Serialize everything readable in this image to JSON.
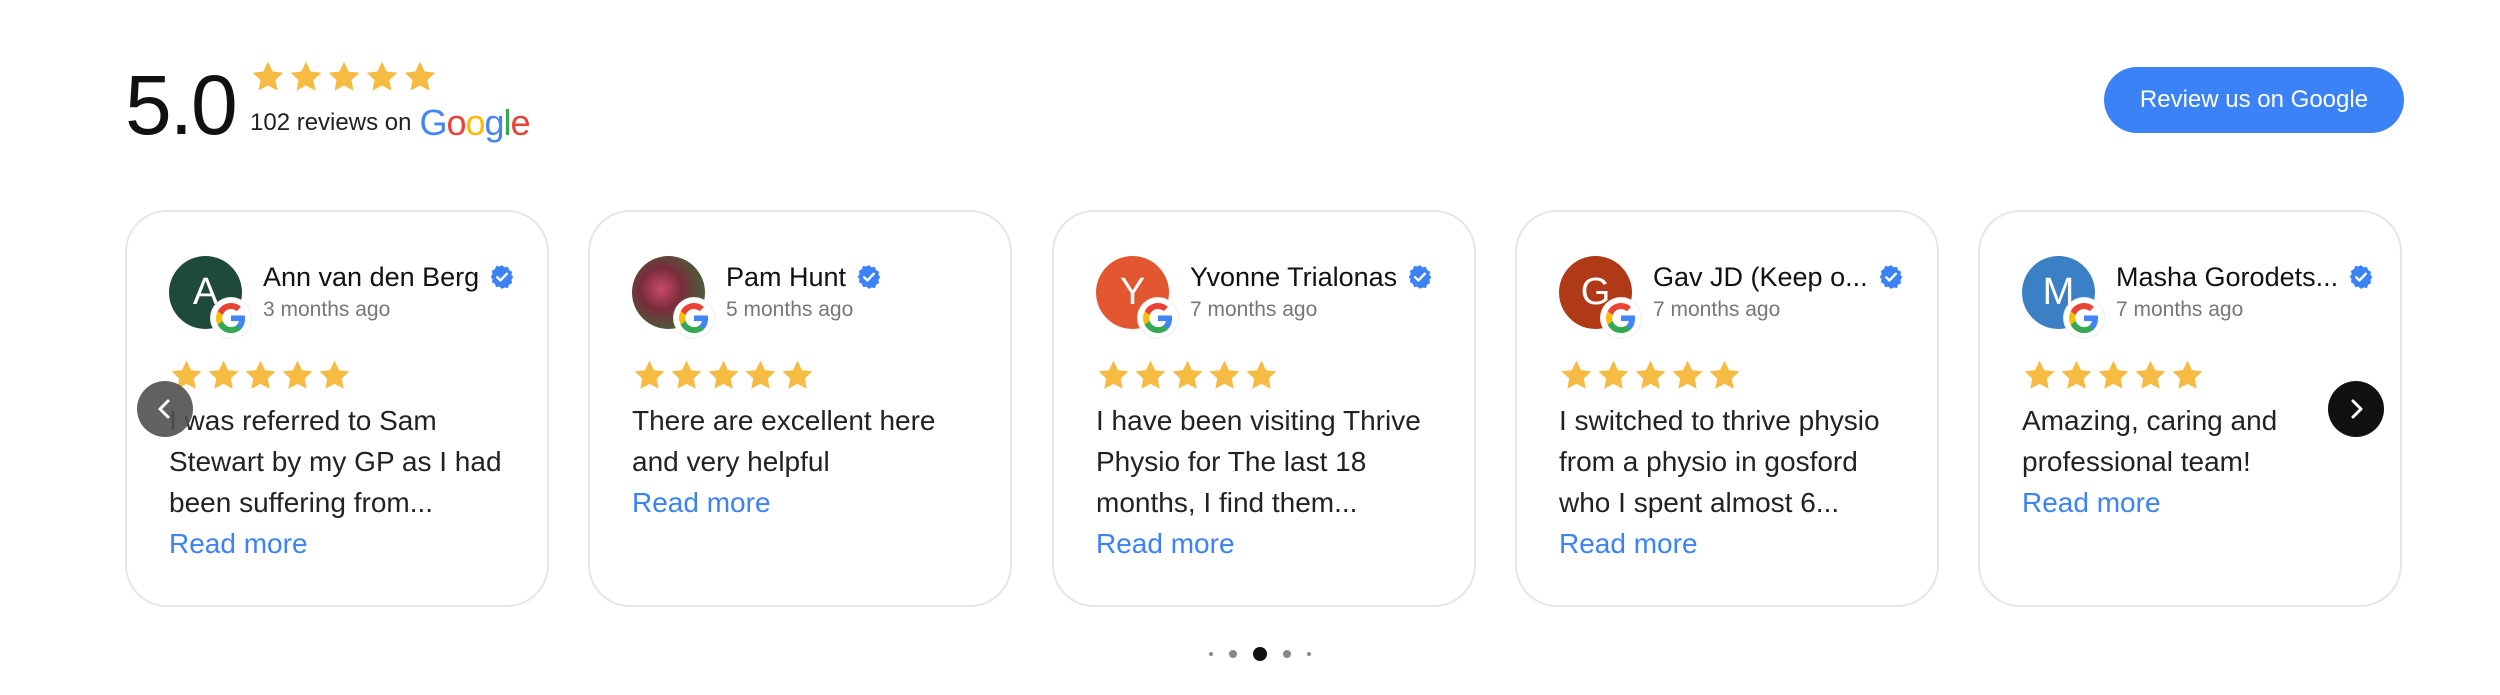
{
  "summary": {
    "score": "5.0",
    "reviews_text": "102 reviews on",
    "google_letters": [
      "G",
      "o",
      "o",
      "g",
      "l",
      "e"
    ]
  },
  "cta": {
    "label": "Review us on Google"
  },
  "colors": {
    "star": "#F6BB42",
    "accent": "#3b82f6",
    "verified": "#3b82f6"
  },
  "reviews": [
    {
      "initial": "A",
      "avatar_color": "#1f4a3a",
      "name": "Ann van den Berg",
      "time": "3 months ago",
      "rating": 5,
      "text": "I was referred to Sam Stewart by my GP as I had been suffering from...",
      "read_more": "Read more"
    },
    {
      "initial": "",
      "avatar_color": "photo",
      "name": "Pam Hunt",
      "time": "5 months ago",
      "rating": 5,
      "text": "There are excellent here and very helpful",
      "read_more": "Read more"
    },
    {
      "initial": "Y",
      "avatar_color": "#e2572f",
      "name": "Yvonne Trialonas",
      "time": "7 months ago",
      "rating": 5,
      "text": "I have been visiting Thrive Physio for The last 18 months, I find them...",
      "read_more": "Read more"
    },
    {
      "initial": "G",
      "avatar_color": "#b03a17",
      "name": "Gav JD (Keep o...",
      "time": "7 months ago",
      "rating": 5,
      "text": "I switched to thrive physio from a physio in gosford who I spent almost 6...",
      "read_more": "Read more"
    },
    {
      "initial": "M",
      "avatar_color": "#3b7fc4",
      "name": "Masha Gorodets...",
      "time": "7 months ago",
      "rating": 5,
      "text": "Amazing, caring and professional team!",
      "read_more": "Read more"
    }
  ],
  "nav": {
    "prev_icon": "chevron-left-icon",
    "next_icon": "chevron-right-icon"
  },
  "pagination": {
    "total": 5,
    "active": 2
  }
}
